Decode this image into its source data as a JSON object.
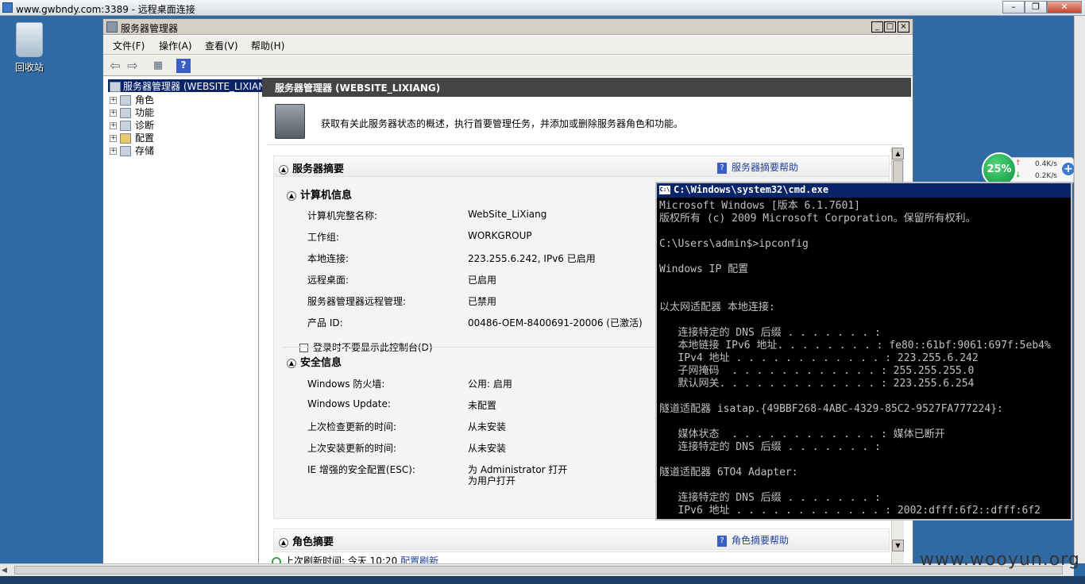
{
  "remote_desktop": {
    "title": "www.gwbndy.com:3389 - 远程桌面连接",
    "minimize": "–",
    "restore": "❐",
    "close": "✕"
  },
  "desktop": {
    "recycle_bin": "回收站"
  },
  "server_manager": {
    "title": "服务器管理器",
    "menu": [
      "文件(F)",
      "操作(A)",
      "查看(V)",
      "帮助(H)"
    ],
    "toolbar": {
      "back": "⇦",
      "forward": "⇨",
      "view": "▦",
      "help": "?"
    },
    "tree": {
      "root": "服务器管理器 (WEBSITE_LIXIAN",
      "items": [
        "角色",
        "功能",
        "诊断",
        "配置",
        "存储"
      ]
    },
    "content": {
      "header": "服务器管理器 (WEBSITE_LIXIANG)",
      "intro": "获取有关此服务器状态的概述，执行首要管理任务，并添加或删除服务器角色和功能。",
      "server_summary": {
        "title": "服务器摘要",
        "help": "服务器摘要帮助",
        "computer_info": {
          "title": "计算机信息",
          "rows": [
            {
              "label": "计算机完整名称:",
              "value": "WebSite_LiXiang"
            },
            {
              "label": "工作组:",
              "value": "WORKGROUP"
            },
            {
              "label": "本地连接:",
              "value": "223.255.6.242, IPv6 已启用"
            },
            {
              "label": "远程桌面:",
              "value": "已启用"
            },
            {
              "label": "服务器管理器远程管理:",
              "value": "已禁用"
            },
            {
              "label": "产品 ID:",
              "value": "00486-OEM-8400691-20006 (已激活)"
            }
          ],
          "checkbox": "登录时不要显示此控制台(D)"
        },
        "security_info": {
          "title": "安全信息",
          "rows": [
            {
              "label": "Windows 防火墙:",
              "value": "公用: 启用"
            },
            {
              "label": "Windows Update:",
              "value": "未配置"
            },
            {
              "label": "上次检查更新的时间:",
              "value": "从未安装"
            },
            {
              "label": "上次安装更新的时间:",
              "value": "从未安装"
            },
            {
              "label": "IE 增强的安全配置(ESC):",
              "value": "为 Administrator 打开"
            }
          ],
          "esc_value_line2": "为用户打开"
        }
      },
      "roles_summary": {
        "title": "角色摘要",
        "help": "角色摘要帮助"
      },
      "refresh": {
        "label": "上次刷新时间: 今天 10:20",
        "link": "配置刷新"
      }
    }
  },
  "cmd": {
    "title": "C:\\Windows\\system32\\cmd.exe",
    "lines": [
      "Microsoft Windows [版本 6.1.7601]",
      "版权所有 (c) 2009 Microsoft Corporation。保留所有权利。",
      "",
      "C:\\Users\\admin$>ipconfig",
      "",
      "Windows IP 配置",
      "",
      "",
      "以太网适配器 本地连接:",
      "",
      "   连接特定的 DNS 后缀 . . . . . . . :",
      "   本地链接 IPv6 地址. . . . . . . . : fe80::61bf:9061:697f:5eb4%",
      "   IPv4 地址 . . . . . . . . . . . . : 223.255.6.242",
      "   子网掩码  . . . . . . . . . . . . : 255.255.255.0",
      "   默认网关. . . . . . . . . . . . . : 223.255.6.254",
      "",
      "隧道适配器 isatap.{49BBF268-4ABC-4329-85C2-9527FA777224}:",
      "",
      "   媒体状态  . . . . . . . . . . . . : 媒体已断开",
      "   连接特定的 DNS 后缀 . . . . . . . :",
      "",
      "隧道适配器 6TO4 Adapter:",
      "",
      "   连接特定的 DNS 后缀 . . . . . . . :",
      "   IPv6 地址 . . . . . . . . . . . . : 2002:dfff:6f2::dfff:6f2"
    ]
  },
  "net_monitor": {
    "percent": "25%",
    "up": "0.4K/s",
    "down": "0.2K/s",
    "up_arrow": "↑",
    "down_arrow": "↓",
    "plus": "+"
  },
  "watermark": "www.wooyun.org"
}
